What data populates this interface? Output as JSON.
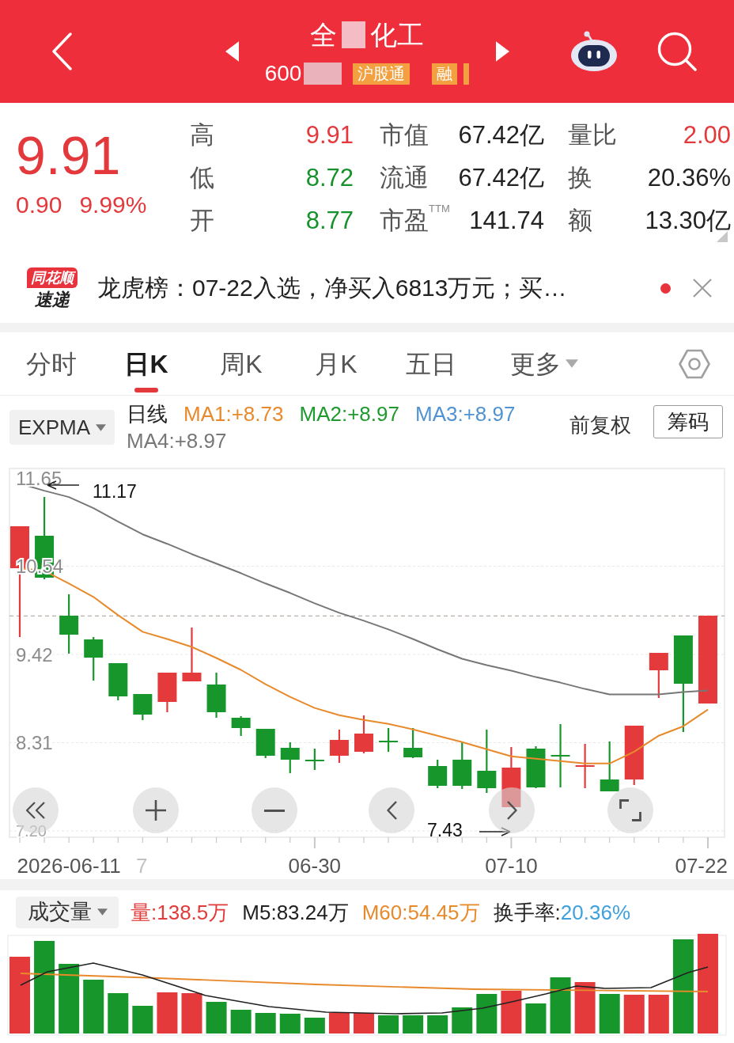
{
  "header": {
    "title_start": "全",
    "title_end": "化工",
    "code_start": "600",
    "tags": [
      "沪股通",
      "融"
    ]
  },
  "quote": {
    "price": "9.91",
    "change": "0.90",
    "change_percent": "9.99%",
    "stats": [
      [
        {
          "label": "高",
          "value": "9.91",
          "color": "#e3393c"
        },
        {
          "label": "市值",
          "value": "67.42亿",
          "color": "#222222"
        },
        {
          "label": "量比",
          "value": "2.00",
          "color": "#e3393c"
        }
      ],
      [
        {
          "label": "低",
          "value": "8.72",
          "color": "#17912b"
        },
        {
          "label": "流通",
          "value": "67.42亿",
          "color": "#222222"
        },
        {
          "label": "换",
          "value": "20.36%",
          "color": "#222222"
        }
      ],
      [
        {
          "label": "开",
          "value": "8.77",
          "color": "#17912b"
        },
        {
          "label": "市盈$^{TTM}$",
          "value": "141.74",
          "color": "#222222"
        },
        {
          "label": "额",
          "value": "13.30亿",
          "color": "#222222"
        }
      ]
    ]
  },
  "news": {
    "source_top": "同花顺",
    "source_bottom": "速递",
    "text": "龙虎榜：07-22入选，净买入6813万元；买…",
    "unread": true
  },
  "tabs": [
    {
      "label": "分时",
      "kind": "tab",
      "selected": false
    },
    {
      "label": "日K",
      "kind": "tab",
      "selected": true
    },
    {
      "label": "周K",
      "kind": "tab",
      "selected": false
    },
    {
      "label": "月K",
      "kind": "tab",
      "selected": false
    },
    {
      "label": "五日",
      "kind": "tab",
      "selected": false
    },
    {
      "label": "更多",
      "kind": "menu",
      "selected": false
    }
  ],
  "indicators": {
    "selector": "EXPMA",
    "period": "日线",
    "lines": [
      {
        "label": "MA1:+8.73",
        "color": "#e8892b"
      },
      {
        "label": "MA2:+8.97",
        "color": "#1e9a2e"
      },
      {
        "label": "MA3:+8.97",
        "color": "#4f93d2"
      },
      {
        "label": "MA4:+8.97",
        "color": "#777777"
      }
    ],
    "adjustment": "前复权",
    "chips_button": "筹码"
  },
  "price_chart": {
    "high_marker": "11.17",
    "low_marker": "7.43",
    "date_fragment": "7",
    "chart_data": {
      "type": "line",
      "categories": [
        null,
        null,
        "2026-06-11",
        null,
        null,
        null,
        null,
        null,
        null,
        null,
        null,
        null,
        "06-30",
        null,
        null,
        null,
        null,
        null,
        null,
        null,
        "07-10",
        null,
        null,
        null,
        null,
        null,
        null,
        null,
        "07-22"
      ],
      "series": [
        {
          "color": "#777777",
          "values": [
            11.58,
            11.49,
            11.41,
            11.27,
            11.1,
            10.94,
            10.82,
            10.69,
            10.57,
            10.45,
            10.32,
            10.2,
            10.07,
            9.95,
            9.85,
            9.74,
            9.62,
            9.49,
            9.37,
            9.29,
            9.22,
            9.14,
            9.07,
            8.99,
            8.92,
            8.92,
            8.92,
            8.95,
            8.97
          ]
        },
        {
          "color": "#e8892b",
          "values": [
            10.51,
            10.48,
            10.32,
            10.15,
            9.92,
            9.71,
            9.62,
            9.52,
            9.38,
            9.23,
            9.05,
            8.89,
            8.75,
            8.66,
            8.6,
            8.55,
            8.48,
            8.4,
            8.32,
            8.23,
            8.14,
            8.11,
            8.08,
            8.05,
            8.05,
            8.2,
            8.4,
            8.52,
            8.73
          ]
        }
      ],
      "ylim": [
        7.12,
        11.77
      ],
      "yticks": [
        {
          "value": 11.65,
          "label": "11.65"
        },
        {
          "value": 10.5375,
          "label": "10.54"
        },
        {
          "value": 9.425,
          "label": "9.42"
        },
        {
          "value": 8.3125,
          "label": "8.31"
        },
        {
          "value": 7.2,
          "label": "7.20"
        }
      ],
      "grid": true,
      "ref_lines": [
        {
          "axis": "y",
          "value": 9.91
        }
      ]
    }
  },
  "volume": {
    "selector": "成交量",
    "readings": [
      [
        {
          "text": "量:138.5万",
          "color": "#e23b3b"
        }
      ],
      [
        {
          "text": "M5:83.24万",
          "color": "#222222"
        }
      ],
      [
        {
          "text": "M60:54.45万",
          "color": "#e8892b"
        }
      ],
      [
        {
          "text": "换手率:",
          "color": "#222222"
        },
        {
          "text": "20.36%",
          "color": "#3fa0dc"
        }
      ]
    ]
  }
}
